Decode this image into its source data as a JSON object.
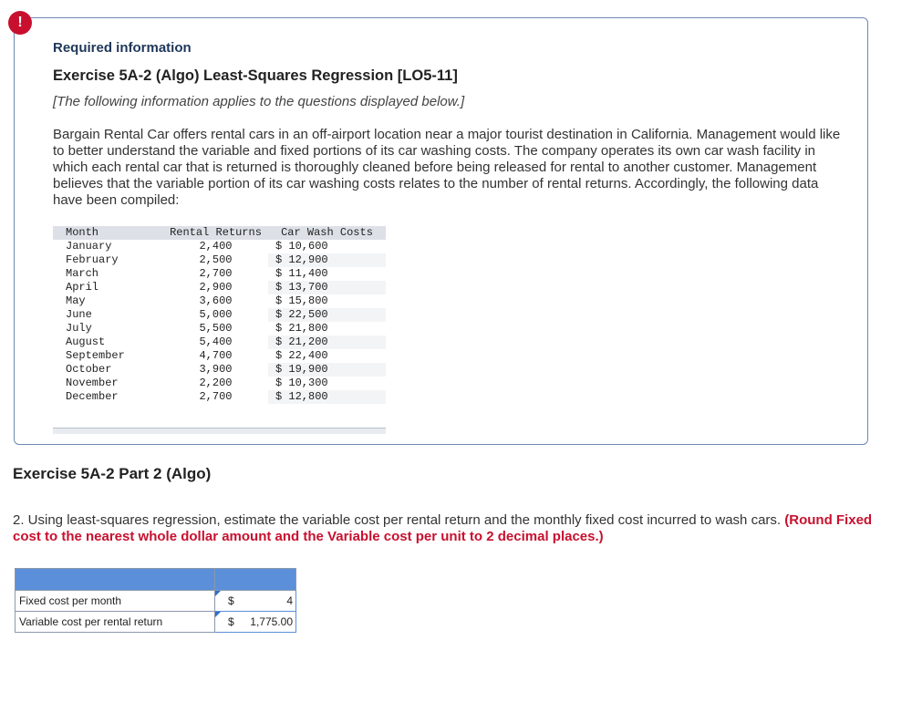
{
  "alert": {
    "glyph": "!"
  },
  "info": {
    "required_label": "Required information",
    "exercise_title": "Exercise 5A-2 (Algo) Least-Squares Regression [LO5-11]",
    "note": "[The following information applies to the questions displayed below.]",
    "paragraph": "Bargain Rental Car offers rental cars in an off-airport location near a major tourist destination in California. Management would like to better understand the variable and fixed portions of its car washing costs. The company operates its own car wash facility in which each rental car that is returned is thoroughly cleaned before being released for rental to another customer. Management believes that the variable portion of its car washing costs relates to the number of rental returns. Accordingly, the following data have been compiled:"
  },
  "data_table": {
    "headers": {
      "month": "Month",
      "returns": "Rental Returns",
      "costs": "Car Wash Costs"
    },
    "rows": [
      {
        "month": "January",
        "returns": "2,400",
        "cost": "$ 10,600"
      },
      {
        "month": "February",
        "returns": "2,500",
        "cost": "$ 12,900"
      },
      {
        "month": "March",
        "returns": "2,700",
        "cost": "$ 11,400"
      },
      {
        "month": "April",
        "returns": "2,900",
        "cost": "$ 13,700"
      },
      {
        "month": "May",
        "returns": "3,600",
        "cost": "$ 15,800"
      },
      {
        "month": "June",
        "returns": "5,000",
        "cost": "$ 22,500"
      },
      {
        "month": "July",
        "returns": "5,500",
        "cost": "$ 21,800"
      },
      {
        "month": "August",
        "returns": "5,400",
        "cost": "$ 21,200"
      },
      {
        "month": "September",
        "returns": "4,700",
        "cost": "$ 22,400"
      },
      {
        "month": "October",
        "returns": "3,900",
        "cost": "$ 19,900"
      },
      {
        "month": "November",
        "returns": "2,200",
        "cost": "$ 10,300"
      },
      {
        "month": "December",
        "returns": "2,700",
        "cost": "$ 12,800"
      }
    ]
  },
  "part": {
    "title": "Exercise 5A-2 Part 2 (Algo)",
    "question_text": "2. Using least-squares regression, estimate the variable cost per rental return and the monthly fixed cost incurred to wash cars.",
    "question_emphasis": "(Round Fixed cost to the nearest whole dollar amount and the Variable cost per unit to 2 decimal places.)"
  },
  "answer_table": {
    "rows": [
      {
        "label": "Fixed cost per month",
        "currency": "$",
        "value": "4"
      },
      {
        "label": "Variable cost per rental return",
        "currency": "$",
        "value": "1,775.00"
      }
    ]
  },
  "colors": {
    "alert": "#c8102e",
    "header_blue": "#5b8fd9",
    "box_border": "#6d89b0"
  }
}
